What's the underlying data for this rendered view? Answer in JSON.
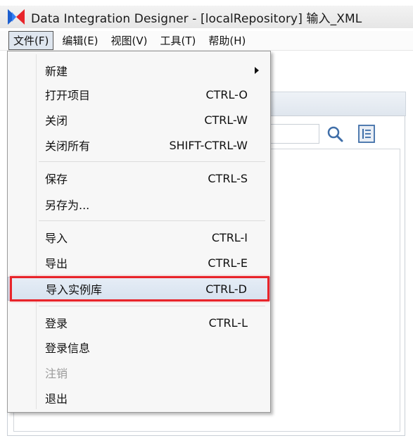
{
  "window": {
    "title": "Data Integration Designer - [localRepository] 输入_XML"
  },
  "menubar": {
    "items": [
      {
        "label": "文件(F)"
      },
      {
        "label": "编辑(E)"
      },
      {
        "label": "视图(V)"
      },
      {
        "label": "工具(T)"
      },
      {
        "label": "帮助(H)"
      }
    ]
  },
  "file_menu": {
    "items": [
      {
        "label": "新建",
        "shortcut": ""
      },
      {
        "label": "打开项目",
        "shortcut": "CTRL-O"
      },
      {
        "label": "关闭",
        "shortcut": "CTRL-W"
      },
      {
        "label": "关闭所有",
        "shortcut": "SHIFT-CTRL-W"
      },
      {
        "label": "保存",
        "shortcut": "CTRL-S"
      },
      {
        "label": "另存为...",
        "shortcut": ""
      },
      {
        "label": "导入",
        "shortcut": "CTRL-I"
      },
      {
        "label": "导出",
        "shortcut": "CTRL-E"
      },
      {
        "label": "导入实例库",
        "shortcut": "CTRL-D"
      },
      {
        "label": "登录",
        "shortcut": "CTRL-L"
      },
      {
        "label": "登录信息",
        "shortcut": ""
      },
      {
        "label": "注销",
        "shortcut": ""
      },
      {
        "label": "退出",
        "shortcut": ""
      }
    ]
  },
  "colors": {
    "highlight_box": "#e8242a",
    "menu_background": "#f7f7f7",
    "disabled_text": "#9a9a9a"
  },
  "icons": {
    "app_logo": "app-logo-icon",
    "search": "search-icon",
    "list": "list-icon",
    "submenu": "chevron-right-icon"
  }
}
